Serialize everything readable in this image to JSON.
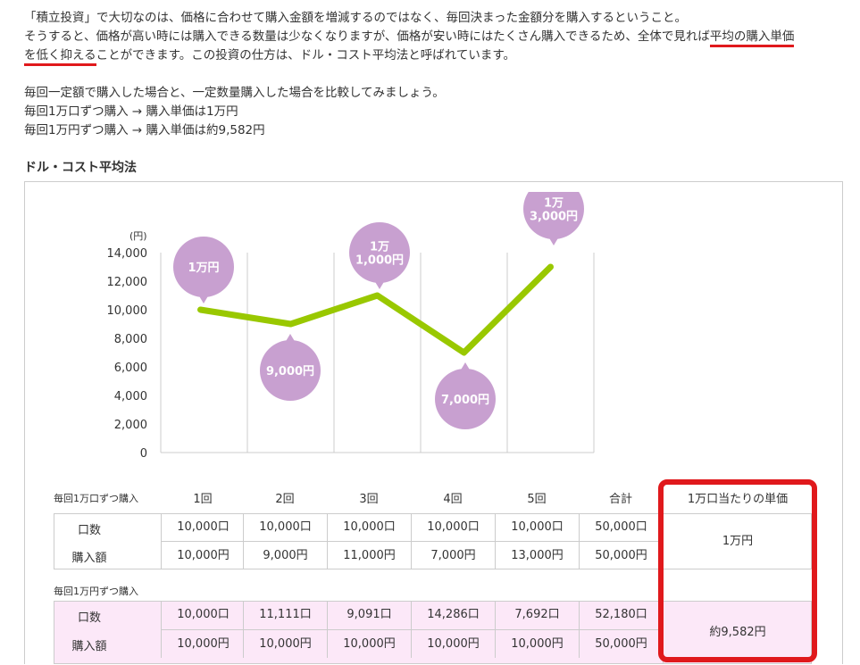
{
  "intro": {
    "line1": "「積立投資」で大切なのは、価格に合わせて購入金額を増減するのではなく、毎回決まった金額分を購入するということ。",
    "line2_a": "そうすると、価格が高い時には購入できる数量は少なくなりますが、価格が安い時にはたくさん購入できるため、全体で見れば",
    "line2_b": "平均の購入単価",
    "line3_a": "を低く抑える",
    "line3_b": "ことができます。この投資の仕方は、ドル・コスト平均法と呼ばれています。"
  },
  "compare": {
    "line1": "毎回一定額で購入した場合と、一定数量購入した場合を比較してみましょう。",
    "line2": "毎回1万口ずつ購入 → 購入単価は1万円",
    "line3": "毎回1万円ずつ購入 → 購入単価は約9,582円"
  },
  "section_title": "ドル・コスト平均法",
  "chart_data": {
    "type": "line",
    "unit_label": "(円)",
    "yticks": [
      "14,000",
      "12,000",
      "10,000",
      "8,000",
      "6,000",
      "4,000",
      "2,000",
      "0"
    ],
    "ylim": [
      0,
      14000
    ],
    "x": [
      1,
      2,
      3,
      4,
      5
    ],
    "values": [
      10000,
      9000,
      11000,
      7000,
      13000
    ],
    "bubble_labels": [
      [
        "1万円"
      ],
      [
        "9,000円"
      ],
      [
        "1万",
        "1,000円"
      ],
      [
        "7,000円"
      ],
      [
        "1万",
        "3,000円"
      ]
    ],
    "line_color": "#99c800",
    "bubble_color": "#c8a0d0"
  },
  "table": {
    "section1_label": "毎回1万口ずつ購入",
    "columns": [
      "1回",
      "2回",
      "3回",
      "4回",
      "5回",
      "合計"
    ],
    "unit_header": "1万口当たりの単価",
    "section1_rows": [
      {
        "label": "口数",
        "values": [
          "10,000口",
          "10,000口",
          "10,000口",
          "10,000口",
          "10,000口",
          "50,000口"
        ]
      },
      {
        "label": "購入額",
        "values": [
          "10,000円",
          "9,000円",
          "11,000円",
          "7,000円",
          "13,000円",
          "50,000円"
        ]
      }
    ],
    "section1_unit": "1万円",
    "section2_label": "毎回1万円ずつ購入",
    "section2_rows": [
      {
        "label": "口数",
        "values": [
          "10,000口",
          "11,111口",
          "9,091口",
          "14,286口",
          "7,692口",
          "52,180口"
        ]
      },
      {
        "label": "購入額",
        "values": [
          "10,000円",
          "10,000円",
          "10,000円",
          "10,000円",
          "10,000円",
          "50,000円"
        ]
      }
    ],
    "section2_unit": "約9,582円"
  },
  "colors": {
    "highlight_red": "#e0191c",
    "pink_bg": "#fce8f8"
  }
}
